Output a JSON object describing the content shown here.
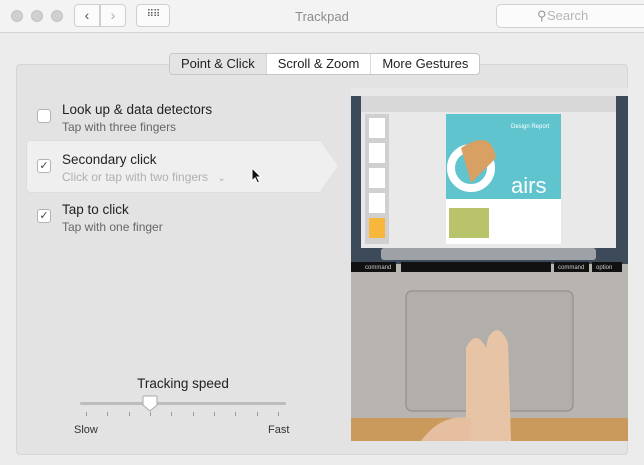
{
  "window": {
    "title": "Trackpad",
    "search_placeholder": "Search"
  },
  "tabs": [
    {
      "label": "Point & Click",
      "active": true
    },
    {
      "label": "Scroll & Zoom",
      "active": false
    },
    {
      "label": "More Gestures",
      "active": false
    }
  ],
  "options": [
    {
      "label": "Look up & data detectors",
      "sub": "Tap with three fingers",
      "checked": false
    },
    {
      "label": "Secondary click",
      "sub": "Click or tap with two fingers",
      "checked": true,
      "selected": true
    },
    {
      "label": "Tap to click",
      "sub": "Tap with one finger",
      "checked": true
    }
  ],
  "tracking": {
    "label": "Tracking speed",
    "min_label": "Slow",
    "max_label": "Fast",
    "value_fraction": 0.333,
    "ticks": 10
  },
  "preview": {
    "doc_title": "Design Report",
    "keys": [
      "command",
      "command",
      "option"
    ]
  },
  "icons": {
    "check": "✓"
  }
}
